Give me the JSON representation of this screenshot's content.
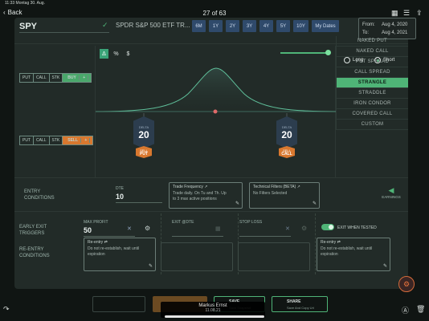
{
  "statusbar": {
    "time": "11:33",
    "date": "Montag 30. Aug.",
    "battery": ""
  },
  "nav": {
    "back_label": "Back",
    "page_counter": "27 of 63"
  },
  "header": {
    "ticker": "SPY",
    "ticker_name": "SPDR S&P 500 ETF TR...",
    "ranges": [
      "6M",
      "1Y",
      "2Y",
      "3Y",
      "4Y",
      "5Y",
      "10Y",
      "My Dates"
    ],
    "from_label": "From:",
    "from_value": "Aug 4, 2020",
    "to_label": "To:",
    "to_value": "Aug 4, 2021"
  },
  "strategy": {
    "modes": [
      "Δ",
      "%",
      "$"
    ],
    "legs": [
      {
        "opts": [
          "PUT",
          "CALL",
          "STK"
        ],
        "action": "BUY"
      },
      {
        "opts": [
          "PUT",
          "CALL",
          "STK"
        ],
        "action": "SELL"
      }
    ],
    "strikes": [
      {
        "label": "DELTA",
        "value": "20",
        "badge_top": "SELL",
        "badge_bottom": "PUT"
      },
      {
        "label": "DELTA",
        "value": "20",
        "badge_top": "SELL",
        "badge_bottom": "CALL"
      }
    ],
    "direction": {
      "long": "Long",
      "short": "Short"
    },
    "list": [
      "NAKED PUT",
      "NAKED CALL",
      "PUT SPREAD",
      "CALL SPREAD",
      "STRANGLE",
      "STRADDLE",
      "IRON CONDOR",
      "COVERED CALL",
      "CUSTOM"
    ],
    "selected": "STRANGLE",
    "accent": "#4fb477"
  },
  "entry": {
    "section": [
      "ENTRY",
      "CONDITIONS"
    ],
    "dte_label": "DTE",
    "dte_value": "10",
    "trade_freq_title": "Trade Frequency",
    "trade_freq_body": [
      "Trade daily. On Tu and Th. Up",
      "to 3 max active positions"
    ],
    "tech_title": "Technical Filters (BETA)",
    "tech_body": "No Filters Selected",
    "earnings": "EARNINGS"
  },
  "exit": {
    "section_exit": [
      "EARLY EXIT",
      "TRIGGERS"
    ],
    "section_reentry": [
      "RE-ENTRY",
      "CONDITIONS"
    ],
    "max_profit_label": "MAX PROFIT",
    "max_profit_value": "50",
    "exit_dte_label": "EXIT @DTE",
    "stop_loss_label": "STOP LOSS",
    "exit_when_tested": "EXIT WHEN TESTED",
    "reentry_title": "Re-entry",
    "reentry_body": [
      "Do not re-establish, wait until",
      "expiration"
    ]
  },
  "bottom": {
    "save_label": "SAVE",
    "save_sub": "Save Snapshot",
    "share_label": "SHARE",
    "share_sub": "Save And Copy Url"
  },
  "toast": {
    "name": "Markus Ernst",
    "date": "11.08.21"
  }
}
